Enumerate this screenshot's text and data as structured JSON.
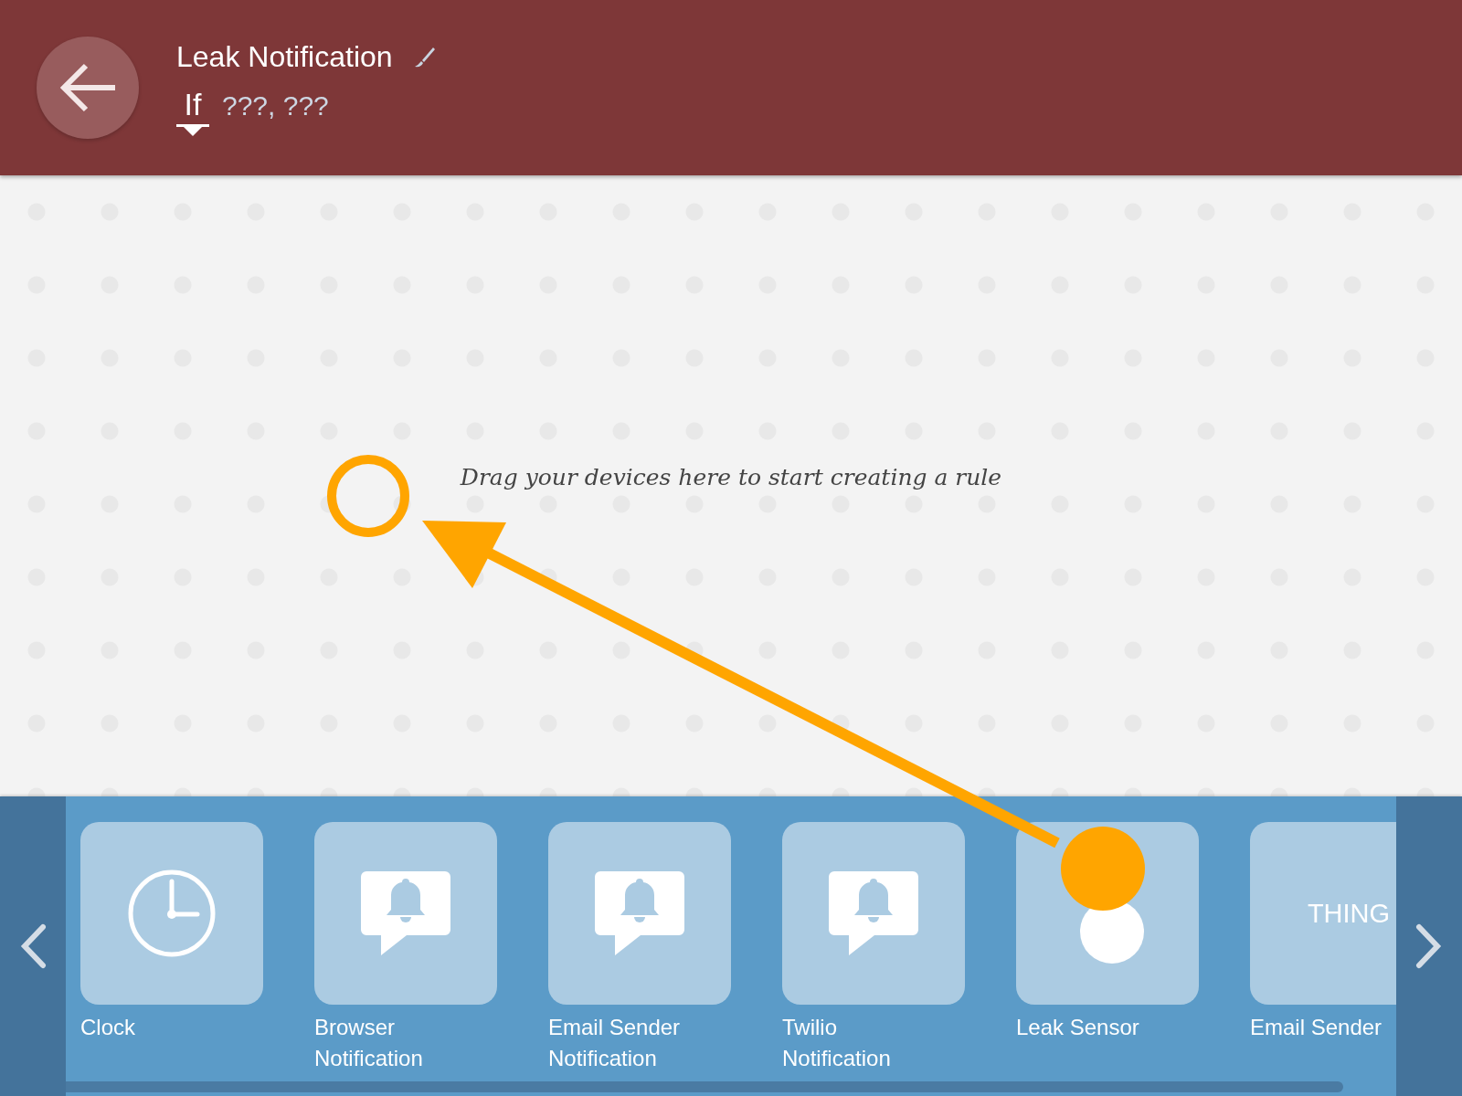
{
  "header": {
    "title": "Leak Notification",
    "trigger": "If",
    "summary": "???, ???"
  },
  "canvas": {
    "hint": "Drag your devices here to start creating a rule"
  },
  "palette": [
    {
      "label": "Clock",
      "kind": "clock"
    },
    {
      "label": "Browser Notification",
      "kind": "notification"
    },
    {
      "label": "Email Sender Notification",
      "kind": "notification"
    },
    {
      "label": "Twilio Notification",
      "kind": "notification"
    },
    {
      "label": "Leak Sensor",
      "kind": "sensor"
    },
    {
      "label": "Email Sender",
      "kind": "thing",
      "icon_text": "THING"
    }
  ]
}
